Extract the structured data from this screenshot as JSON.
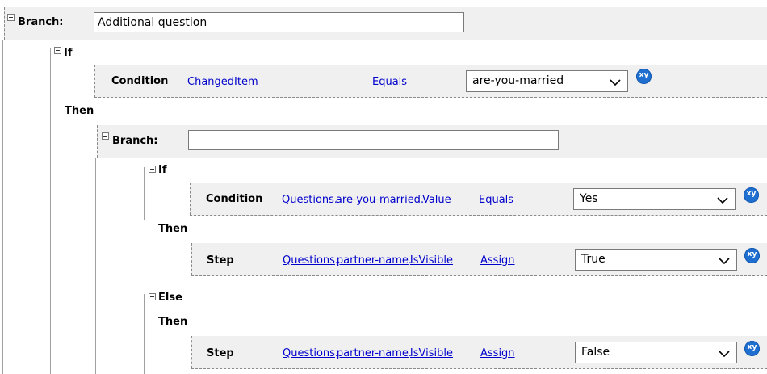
{
  "root": {
    "branch_label": "Branch:",
    "name_value": "Additional question",
    "if_label": "If",
    "condition": {
      "label": "Condition",
      "field": [
        "ChangedItem"
      ],
      "operator": "Equals",
      "value": "are-you-married"
    },
    "then_label": "Then"
  },
  "nested": {
    "branch_label": "Branch:",
    "name_value": "",
    "if_label": "If",
    "condition": {
      "label": "Condition",
      "field": [
        "Questions",
        "are-you-married",
        "Value"
      ],
      "operator": "Equals",
      "value": "Yes"
    },
    "then_label": "Then",
    "step1": {
      "label": "Step",
      "field": [
        "Questions",
        "partner-name",
        "IsVisible"
      ],
      "operator": "Assign",
      "value": "True"
    },
    "else_label": "Else",
    "else_then_label": "Then",
    "step2": {
      "label": "Step",
      "field": [
        "Questions",
        "partner-name",
        "IsVisible"
      ],
      "operator": "Assign",
      "value": "False"
    }
  },
  "icons": {
    "collapse": "minus-box-icon",
    "variable": "xy-variable-icon",
    "dropdown": "chevron-down-icon"
  },
  "variable_icon_text": "xy",
  "colors": {
    "link": "#0000cc",
    "band": "#f0f0f0",
    "variable_icon": "#1f6fd1"
  }
}
